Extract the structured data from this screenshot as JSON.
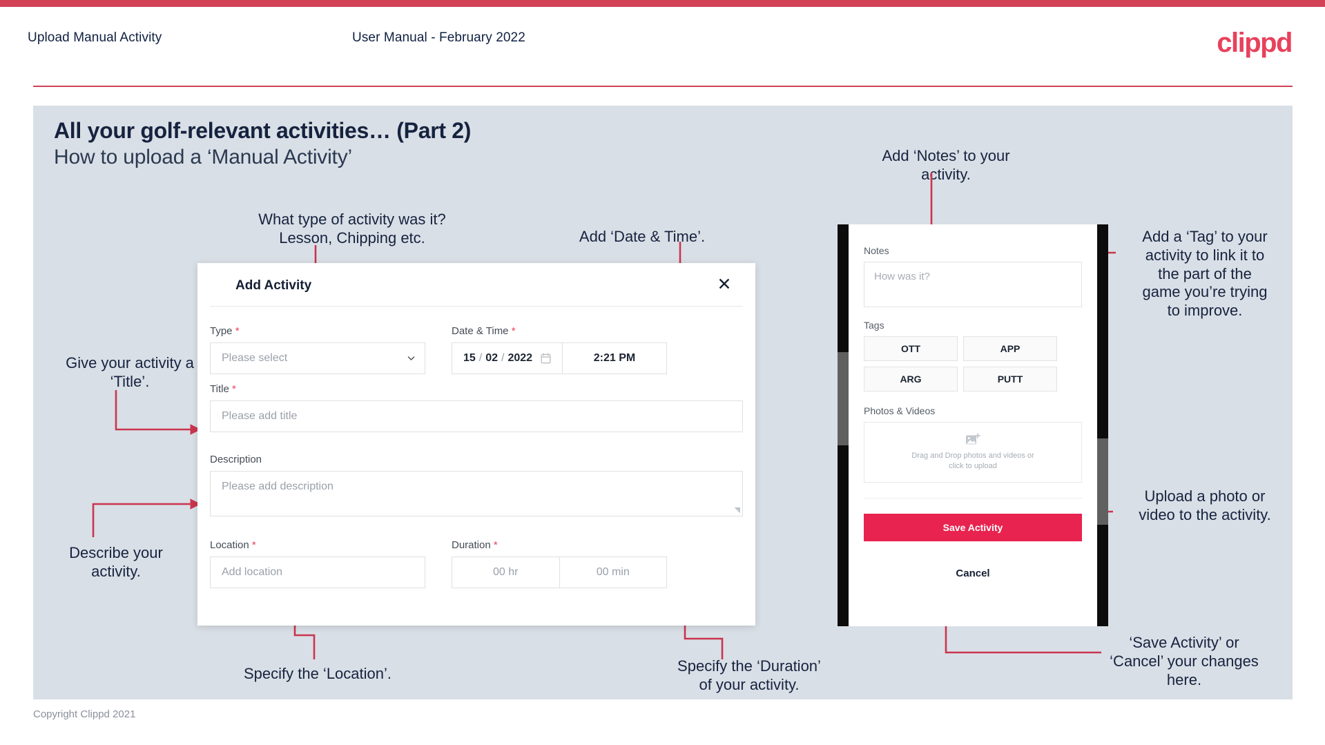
{
  "header": {
    "title": "Upload Manual Activity",
    "subtitle": "User Manual - February 2022",
    "logo": "clippd"
  },
  "slide": {
    "title": "All your golf-relevant activities… (Part 2)",
    "subtitle": "How to upload a ‘Manual Activity’"
  },
  "footer": {
    "copyright": "Copyright Clippd 2021"
  },
  "annotations": {
    "type": "What type of activity was it?\nLesson, Chipping etc.",
    "datetime": "Add ‘Date & Time’.",
    "title": "Give your activity a\n‘Title’.",
    "description": "Describe your\nactivity.",
    "location": "Specify the ‘Location’.",
    "duration": "Specify the ‘Duration’\nof your activity.",
    "notes": "Add ‘Notes’ to your\nactivity.",
    "tags": "Add a ‘Tag’ to your\nactivity to link it to\nthe part of the\ngame you’re trying\nto improve.",
    "upload": "Upload a photo or\nvideo to the activity.",
    "save_cancel": "‘Save Activity’ or\n‘Cancel’ your changes\nhere."
  },
  "modal": {
    "title": "Add Activity",
    "close_icon": "close-icon",
    "fields": {
      "type": {
        "label": "Type",
        "required": "*",
        "placeholder": "Please select",
        "chevron": "chevron-down-icon"
      },
      "datetime": {
        "label": "Date & Time",
        "required": "*",
        "day": "15",
        "month": "02",
        "year": "2022",
        "sep": "/",
        "calendar_icon": "calendar-icon",
        "time": "2:21 PM"
      },
      "title": {
        "label": "Title",
        "required": "*",
        "placeholder": "Please add title"
      },
      "description": {
        "label": "Description",
        "required": "",
        "placeholder": "Please add description"
      },
      "location": {
        "label": "Location",
        "required": "*",
        "placeholder": "Add location"
      },
      "duration": {
        "label": "Duration",
        "required": "*",
        "hours_placeholder": "00 hr",
        "minutes_placeholder": "00 min"
      }
    }
  },
  "phone": {
    "notes": {
      "label": "Notes",
      "placeholder": "How was it?"
    },
    "tags": {
      "label": "Tags",
      "items": [
        "OTT",
        "APP",
        "ARG",
        "PUTT"
      ]
    },
    "photos": {
      "label": "Photos & Videos",
      "icon": "add-image-icon",
      "drop_line1": "Drag and Drop photos and videos or",
      "drop_line2": "click to upload"
    },
    "save_label": "Save Activity",
    "cancel_label": "Cancel"
  },
  "colors": {
    "brand": "#e8415c",
    "accent": "#d14257",
    "save_button": "#e8234f",
    "slide_bg": "#d9dfe6",
    "text_dark": "#16233f"
  }
}
